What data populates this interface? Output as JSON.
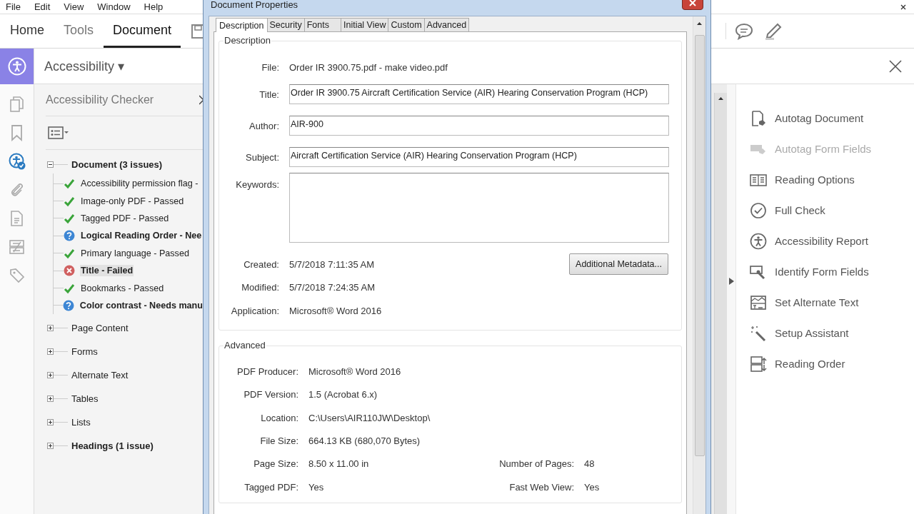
{
  "menu_bar": {
    "items": [
      "File",
      "Edit",
      "View",
      "Window",
      "Help"
    ]
  },
  "top_tabs": [
    {
      "label": "Home",
      "selected": false
    },
    {
      "label": "Tools",
      "selected": false
    },
    {
      "label": "Document",
      "selected": true
    }
  ],
  "rail": [
    {
      "selected": false
    },
    {
      "selected": false
    },
    {
      "selected": true
    },
    {
      "selected": false
    },
    {
      "selected": false
    },
    {
      "selected": false
    },
    {
      "selected": false
    }
  ],
  "panel_header": {
    "title": "Accessibility ▾"
  },
  "checker": {
    "title": "Accessibility Checker",
    "tree": [
      {
        "label": "Document (3 issues)",
        "expanded": true,
        "flagged": true,
        "children": [
          {
            "label": "Accessibility permission flag -",
            "kind": "passed",
            "selected": false
          },
          {
            "label": "Image-only PDF - Passed",
            "kind": "passed",
            "selected": false
          },
          {
            "label": "Tagged PDF - Passed",
            "kind": "passed",
            "selected": false
          },
          {
            "label": "Logical Reading Order - Nee",
            "kind": "manual",
            "selected": false
          },
          {
            "label": "Primary language - Passed",
            "kind": "passed",
            "selected": false
          },
          {
            "label": "Title - Failed",
            "kind": "failed",
            "selected": true
          },
          {
            "label": "Bookmarks - Passed",
            "kind": "passed",
            "selected": false
          },
          {
            "label": "Color contrast - Needs manu",
            "kind": "manual",
            "selected": false
          }
        ]
      },
      {
        "label": "Page Content",
        "expanded": false,
        "flagged": false
      },
      {
        "label": "Forms",
        "expanded": false,
        "flagged": false
      },
      {
        "label": "Alternate Text",
        "expanded": false,
        "flagged": false
      },
      {
        "label": "Tables",
        "expanded": false,
        "flagged": false
      },
      {
        "label": "Lists",
        "expanded": false,
        "flagged": false
      },
      {
        "label": "Headings (1 issue)",
        "expanded": false,
        "flagged": true
      }
    ]
  },
  "tools_panel": {
    "items": [
      {
        "label": "Autotag Document",
        "disabled": false
      },
      {
        "label": "Autotag Form Fields",
        "disabled": true
      },
      {
        "label": "Reading Options",
        "disabled": false
      },
      {
        "label": "Full Check",
        "disabled": false
      },
      {
        "label": "Accessibility Report",
        "disabled": false
      },
      {
        "label": "Identify Form Fields",
        "disabled": false
      },
      {
        "label": "Set Alternate Text",
        "disabled": false
      },
      {
        "label": "Setup Assistant",
        "disabled": false
      },
      {
        "label": "Reading Order",
        "disabled": false
      }
    ]
  },
  "dialog": {
    "title": "Document Properties",
    "tabs": [
      {
        "label": "Description",
        "selected": true
      },
      {
        "label": "Security",
        "selected": false
      },
      {
        "label": "Fonts",
        "selected": false
      },
      {
        "label": "Initial View",
        "selected": false
      },
      {
        "label": "Custom",
        "selected": false
      },
      {
        "label": "Advanced",
        "selected": false
      }
    ],
    "description": {
      "title": "Description",
      "fields": [
        {
          "label": "File:",
          "value": "Order IR 3900.75.pdf - make video.pdf",
          "kind": "text"
        },
        {
          "label": "Title:",
          "value": "Order IR 3900.75 Aircraft Certification Service (AIR) Hearing Conservation Program (HCP)",
          "kind": "input"
        },
        {
          "label": "Author:",
          "value": "AIR-900",
          "kind": "input"
        },
        {
          "label": "Subject:",
          "value": "Aircraft Certification Service (AIR) Hearing Conservation Program (HCP)",
          "kind": "input"
        },
        {
          "label": "Keywords:",
          "kind": "textarea"
        }
      ],
      "dates": [
        {
          "label": "Created:",
          "value": "5/7/2018 7:11:35 AM"
        },
        {
          "label": "Modified:",
          "value": "5/7/2018 7:24:35 AM"
        },
        {
          "label": "Application:",
          "value": "Microsoft® Word 2016"
        }
      ],
      "button": "Additional Metadata..."
    },
    "advanced": {
      "title": "Advanced",
      "rows": [
        [
          {
            "label": "PDF Producer:",
            "value": "Microsoft® Word 2016"
          }
        ],
        [
          {
            "label": "PDF Version:",
            "value": "1.5 (Acrobat 6.x)"
          }
        ],
        [
          {
            "label": "Location:",
            "value": "C:\\Users\\AIR110JW\\Desktop\\"
          }
        ],
        [
          {
            "label": "File Size:",
            "value": "664.13 KB (680,070 Bytes)"
          }
        ],
        [
          {
            "label": "Page Size:",
            "value": "8.50 x 11.00 in"
          },
          {
            "label": "Number of Pages:",
            "value": "48"
          }
        ],
        [
          {
            "label": "Tagged PDF:",
            "value": "Yes"
          },
          {
            "label": "Fast Web View:",
            "value": "Yes"
          }
        ]
      ]
    }
  }
}
